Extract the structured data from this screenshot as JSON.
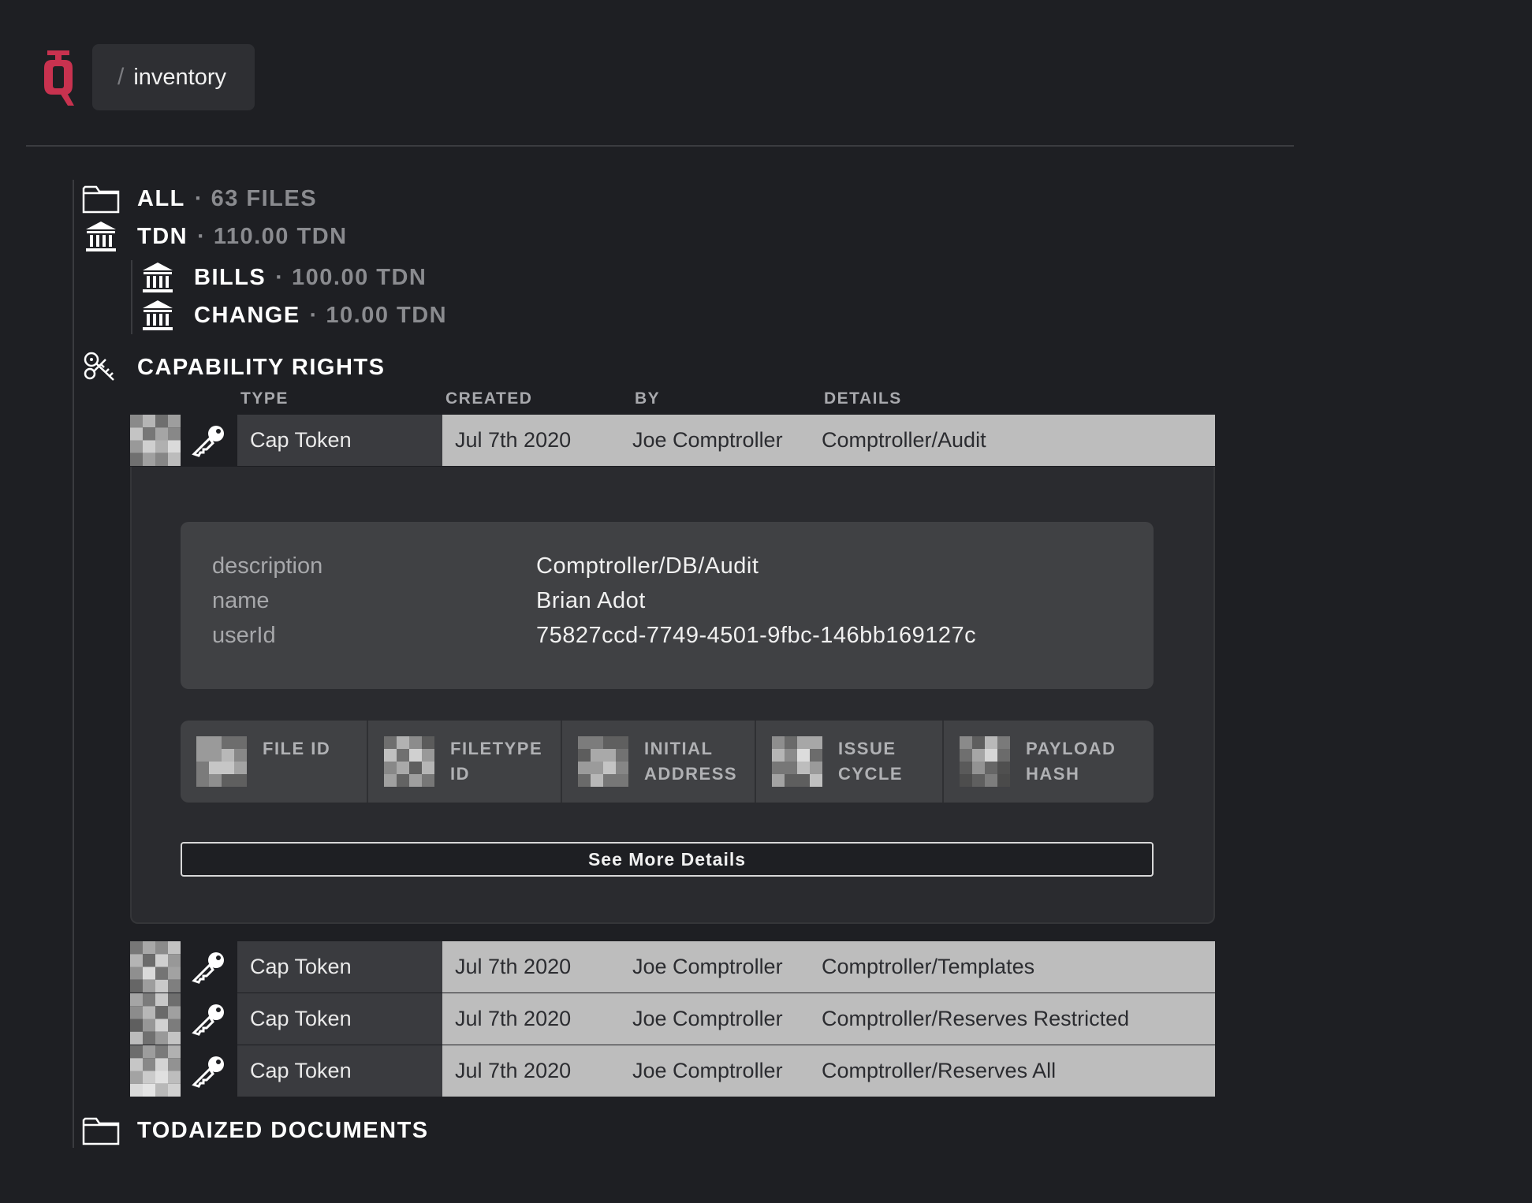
{
  "header": {
    "breadcrumb_separator": "/",
    "breadcrumb_label": "inventory",
    "logo_color": "#c8324f"
  },
  "tree": {
    "all": {
      "label": "ALL",
      "meta": "· 63 FILES",
      "icon": "folder-icon"
    },
    "tdn": {
      "label": "TDN",
      "meta": "· 110.00 TDN",
      "icon": "bank-icon"
    },
    "bills": {
      "label": "BILLS",
      "meta": "· 100.00 TDN",
      "icon": "bank-icon"
    },
    "change": {
      "label": "CHANGE",
      "meta": "· 10.00 TDN",
      "icon": "bank-icon"
    },
    "capability": {
      "label": "CAPABILITY RIGHTS",
      "icon": "keys-icon"
    },
    "todaized": {
      "label": "TODAIZED DOCUMENTS",
      "icon": "folder-icon"
    }
  },
  "table": {
    "headers": {
      "type": "TYPE",
      "created": "CREATED",
      "by": "BY",
      "details": "DETAILS"
    },
    "rows": [
      {
        "type": "Cap Token",
        "created": "Jul 7th 2020",
        "by": "Joe Comptroller",
        "details": "Comptroller/Audit"
      },
      {
        "type": "Cap Token",
        "created": "Jul 7th 2020",
        "by": "Joe Comptroller",
        "details": "Comptroller/Templates"
      },
      {
        "type": "Cap Token",
        "created": "Jul 7th 2020",
        "by": "Joe Comptroller",
        "details": "Comptroller/Reserves Restricted"
      },
      {
        "type": "Cap Token",
        "created": "Jul 7th 2020",
        "by": "Joe Comptroller",
        "details": "Comptroller/Reserves All"
      }
    ]
  },
  "expanded": {
    "fields": [
      {
        "key": "description",
        "value": "Comptroller/DB/Audit"
      },
      {
        "key": "name",
        "value": "Brian Adot"
      },
      {
        "key": "userId",
        "value": "75827ccd-7749-4501-9fbc-146bb169127c"
      }
    ],
    "chips": [
      "FILE ID",
      "FILETYPE\nID",
      "INITIAL\nADDRESS",
      "ISSUE\nCYCLE",
      "PAYLOAD\nHASH"
    ],
    "see_more_label": "See More Details"
  }
}
